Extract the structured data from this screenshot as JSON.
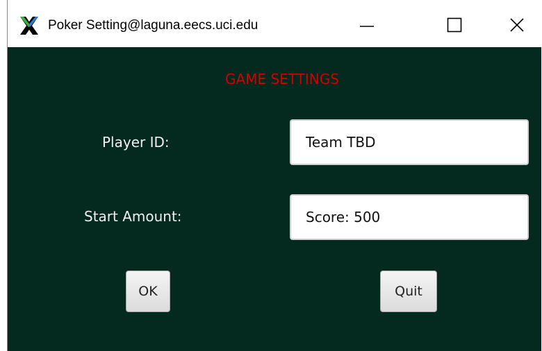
{
  "window": {
    "title": "Poker Setting@laguna.eecs.uci.edu",
    "app_icon": "x11-logo-icon",
    "controls": {
      "minimize_icon": "minimize-icon",
      "maximize_icon": "maximize-icon",
      "close_icon": "close-icon"
    }
  },
  "form": {
    "heading": "GAME SETTINGS",
    "player_id_label": "Player ID:",
    "player_id_value": "Team TBD",
    "start_amount_label": "Start Amount:",
    "start_amount_value": "Score: 500",
    "ok_label": "OK",
    "quit_label": "Quit"
  },
  "colors": {
    "background": "#04291e",
    "heading": "#d40000",
    "label": "#f0f0f0"
  }
}
